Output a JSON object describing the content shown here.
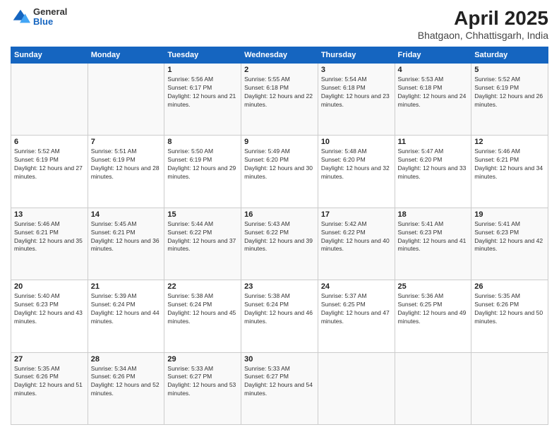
{
  "header": {
    "logo": {
      "general": "General",
      "blue": "Blue"
    },
    "title": "April 2025",
    "subtitle": "Bhatgaon, Chhattisgarh, India"
  },
  "weekdays": [
    "Sunday",
    "Monday",
    "Tuesday",
    "Wednesday",
    "Thursday",
    "Friday",
    "Saturday"
  ],
  "weeks": [
    [
      {
        "day": "",
        "sunrise": "",
        "sunset": "",
        "daylight": ""
      },
      {
        "day": "",
        "sunrise": "",
        "sunset": "",
        "daylight": ""
      },
      {
        "day": "1",
        "sunrise": "Sunrise: 5:56 AM",
        "sunset": "Sunset: 6:17 PM",
        "daylight": "Daylight: 12 hours and 21 minutes."
      },
      {
        "day": "2",
        "sunrise": "Sunrise: 5:55 AM",
        "sunset": "Sunset: 6:18 PM",
        "daylight": "Daylight: 12 hours and 22 minutes."
      },
      {
        "day": "3",
        "sunrise": "Sunrise: 5:54 AM",
        "sunset": "Sunset: 6:18 PM",
        "daylight": "Daylight: 12 hours and 23 minutes."
      },
      {
        "day": "4",
        "sunrise": "Sunrise: 5:53 AM",
        "sunset": "Sunset: 6:18 PM",
        "daylight": "Daylight: 12 hours and 24 minutes."
      },
      {
        "day": "5",
        "sunrise": "Sunrise: 5:52 AM",
        "sunset": "Sunset: 6:19 PM",
        "daylight": "Daylight: 12 hours and 26 minutes."
      }
    ],
    [
      {
        "day": "6",
        "sunrise": "Sunrise: 5:52 AM",
        "sunset": "Sunset: 6:19 PM",
        "daylight": "Daylight: 12 hours and 27 minutes."
      },
      {
        "day": "7",
        "sunrise": "Sunrise: 5:51 AM",
        "sunset": "Sunset: 6:19 PM",
        "daylight": "Daylight: 12 hours and 28 minutes."
      },
      {
        "day": "8",
        "sunrise": "Sunrise: 5:50 AM",
        "sunset": "Sunset: 6:19 PM",
        "daylight": "Daylight: 12 hours and 29 minutes."
      },
      {
        "day": "9",
        "sunrise": "Sunrise: 5:49 AM",
        "sunset": "Sunset: 6:20 PM",
        "daylight": "Daylight: 12 hours and 30 minutes."
      },
      {
        "day": "10",
        "sunrise": "Sunrise: 5:48 AM",
        "sunset": "Sunset: 6:20 PM",
        "daylight": "Daylight: 12 hours and 32 minutes."
      },
      {
        "day": "11",
        "sunrise": "Sunrise: 5:47 AM",
        "sunset": "Sunset: 6:20 PM",
        "daylight": "Daylight: 12 hours and 33 minutes."
      },
      {
        "day": "12",
        "sunrise": "Sunrise: 5:46 AM",
        "sunset": "Sunset: 6:21 PM",
        "daylight": "Daylight: 12 hours and 34 minutes."
      }
    ],
    [
      {
        "day": "13",
        "sunrise": "Sunrise: 5:46 AM",
        "sunset": "Sunset: 6:21 PM",
        "daylight": "Daylight: 12 hours and 35 minutes."
      },
      {
        "day": "14",
        "sunrise": "Sunrise: 5:45 AM",
        "sunset": "Sunset: 6:21 PM",
        "daylight": "Daylight: 12 hours and 36 minutes."
      },
      {
        "day": "15",
        "sunrise": "Sunrise: 5:44 AM",
        "sunset": "Sunset: 6:22 PM",
        "daylight": "Daylight: 12 hours and 37 minutes."
      },
      {
        "day": "16",
        "sunrise": "Sunrise: 5:43 AM",
        "sunset": "Sunset: 6:22 PM",
        "daylight": "Daylight: 12 hours and 39 minutes."
      },
      {
        "day": "17",
        "sunrise": "Sunrise: 5:42 AM",
        "sunset": "Sunset: 6:22 PM",
        "daylight": "Daylight: 12 hours and 40 minutes."
      },
      {
        "day": "18",
        "sunrise": "Sunrise: 5:41 AM",
        "sunset": "Sunset: 6:23 PM",
        "daylight": "Daylight: 12 hours and 41 minutes."
      },
      {
        "day": "19",
        "sunrise": "Sunrise: 5:41 AM",
        "sunset": "Sunset: 6:23 PM",
        "daylight": "Daylight: 12 hours and 42 minutes."
      }
    ],
    [
      {
        "day": "20",
        "sunrise": "Sunrise: 5:40 AM",
        "sunset": "Sunset: 6:23 PM",
        "daylight": "Daylight: 12 hours and 43 minutes."
      },
      {
        "day": "21",
        "sunrise": "Sunrise: 5:39 AM",
        "sunset": "Sunset: 6:24 PM",
        "daylight": "Daylight: 12 hours and 44 minutes."
      },
      {
        "day": "22",
        "sunrise": "Sunrise: 5:38 AM",
        "sunset": "Sunset: 6:24 PM",
        "daylight": "Daylight: 12 hours and 45 minutes."
      },
      {
        "day": "23",
        "sunrise": "Sunrise: 5:38 AM",
        "sunset": "Sunset: 6:24 PM",
        "daylight": "Daylight: 12 hours and 46 minutes."
      },
      {
        "day": "24",
        "sunrise": "Sunrise: 5:37 AM",
        "sunset": "Sunset: 6:25 PM",
        "daylight": "Daylight: 12 hours and 47 minutes."
      },
      {
        "day": "25",
        "sunrise": "Sunrise: 5:36 AM",
        "sunset": "Sunset: 6:25 PM",
        "daylight": "Daylight: 12 hours and 49 minutes."
      },
      {
        "day": "26",
        "sunrise": "Sunrise: 5:35 AM",
        "sunset": "Sunset: 6:26 PM",
        "daylight": "Daylight: 12 hours and 50 minutes."
      }
    ],
    [
      {
        "day": "27",
        "sunrise": "Sunrise: 5:35 AM",
        "sunset": "Sunset: 6:26 PM",
        "daylight": "Daylight: 12 hours and 51 minutes."
      },
      {
        "day": "28",
        "sunrise": "Sunrise: 5:34 AM",
        "sunset": "Sunset: 6:26 PM",
        "daylight": "Daylight: 12 hours and 52 minutes."
      },
      {
        "day": "29",
        "sunrise": "Sunrise: 5:33 AM",
        "sunset": "Sunset: 6:27 PM",
        "daylight": "Daylight: 12 hours and 53 minutes."
      },
      {
        "day": "30",
        "sunrise": "Sunrise: 5:33 AM",
        "sunset": "Sunset: 6:27 PM",
        "daylight": "Daylight: 12 hours and 54 minutes."
      },
      {
        "day": "",
        "sunrise": "",
        "sunset": "",
        "daylight": ""
      },
      {
        "day": "",
        "sunrise": "",
        "sunset": "",
        "daylight": ""
      },
      {
        "day": "",
        "sunrise": "",
        "sunset": "",
        "daylight": ""
      }
    ]
  ]
}
